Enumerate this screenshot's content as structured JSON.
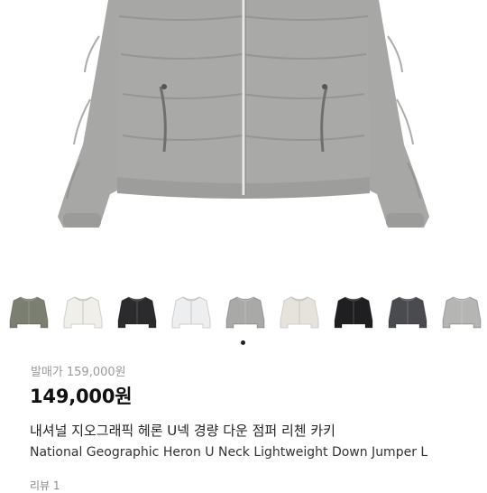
{
  "product": {
    "image_desc": "down-jumper-photo",
    "original_price_label": "발매가",
    "original_price": "159,000원",
    "price": "149,000원",
    "title_ko": "내셔널 지오그래픽 헤론 U넥 경량 다운 점퍼 리첸 카키",
    "title_en": "National Geographic Heron U Neck Lightweight Down Jumper L",
    "review_label": "리뷰 1"
  },
  "thumbnails": [
    {
      "color": "#7b7f71",
      "name": "khaki"
    },
    {
      "color": "#f1efea",
      "name": "ivory"
    },
    {
      "color": "#2b2b2d",
      "name": "black"
    },
    {
      "color": "#eceef0",
      "name": "white"
    },
    {
      "color": "#a9aaa8",
      "name": "grey"
    },
    {
      "color": "#e6e2dc",
      "name": "beige"
    },
    {
      "color": "#1f1f21",
      "name": "black-2"
    },
    {
      "color": "#4a4b4e",
      "name": "charcoal"
    },
    {
      "color": "#b5b5b3",
      "name": "light-grey"
    }
  ],
  "colors": {
    "jacket_main": "#a7a7a5",
    "jacket_shadow": "#8f8f8d",
    "price_text": "#111111",
    "muted_text": "#9a9a9a"
  }
}
